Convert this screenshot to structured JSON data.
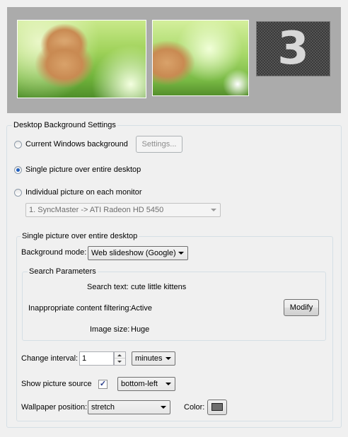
{
  "monitor_preview": {
    "monitor3_number": "3"
  },
  "settings_group": {
    "title": "Desktop Background Settings",
    "radio_current_label": "Current Windows background",
    "settings_button_label": "Settings...",
    "radio_single_label": "Single picture over entire desktop",
    "radio_individual_label": "Individual picture on each monitor",
    "monitor_select_value": "1. SyncMaster -> ATI Radeon HD 5450",
    "selected_option": "single"
  },
  "single_group": {
    "title": "Single picture over entire desktop",
    "background_mode_label": "Background mode:",
    "background_mode_value": "Web slideshow (Google)",
    "search_params": {
      "title": "Search Parameters",
      "search_text_label": "Search text:",
      "search_text_value": "cute little kittens",
      "filtering_label": "Inappropriate content filtering:",
      "filtering_value": "Active",
      "image_size_label": "Image size:",
      "image_size_value": "Huge",
      "modify_button_label": "Modify"
    },
    "change_interval_label": "Change interval:",
    "change_interval_value": "1",
    "interval_unit_value": "minutes",
    "show_source_label": "Show picture source",
    "show_source_checked": true,
    "source_position_value": "bottom-left",
    "wallpaper_position_label": "Wallpaper position:",
    "wallpaper_position_value": "stretch",
    "color_label": "Color:",
    "color_value": "#6e6e6e"
  },
  "colors": {
    "preview_background": "#ababab",
    "window_background": "#f0f0f0",
    "groupbox_border": "#d5dfe5"
  }
}
